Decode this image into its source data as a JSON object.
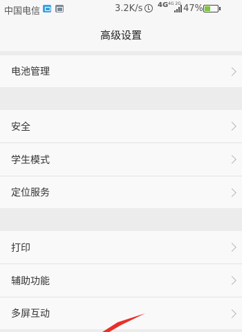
{
  "status_bar": {
    "carrier": "中国电信",
    "speed": "3.2K/s",
    "network": "4G",
    "network_small": "4G 2G",
    "battery_percent": "47%",
    "battery_level": 0.47
  },
  "header": {
    "title": "高级设置"
  },
  "settings": {
    "items": [
      {
        "label": "电池管理"
      },
      {
        "label": "安全"
      },
      {
        "label": "学生模式"
      },
      {
        "label": "定位服务"
      },
      {
        "label": "打印"
      },
      {
        "label": "辅助功能"
      },
      {
        "label": "多屏互动"
      }
    ]
  },
  "colors": {
    "background": "#ececec",
    "row": "#f9f9f9",
    "annotation_arrow": "#e8302a",
    "battery_fill": "#7cc63a"
  }
}
